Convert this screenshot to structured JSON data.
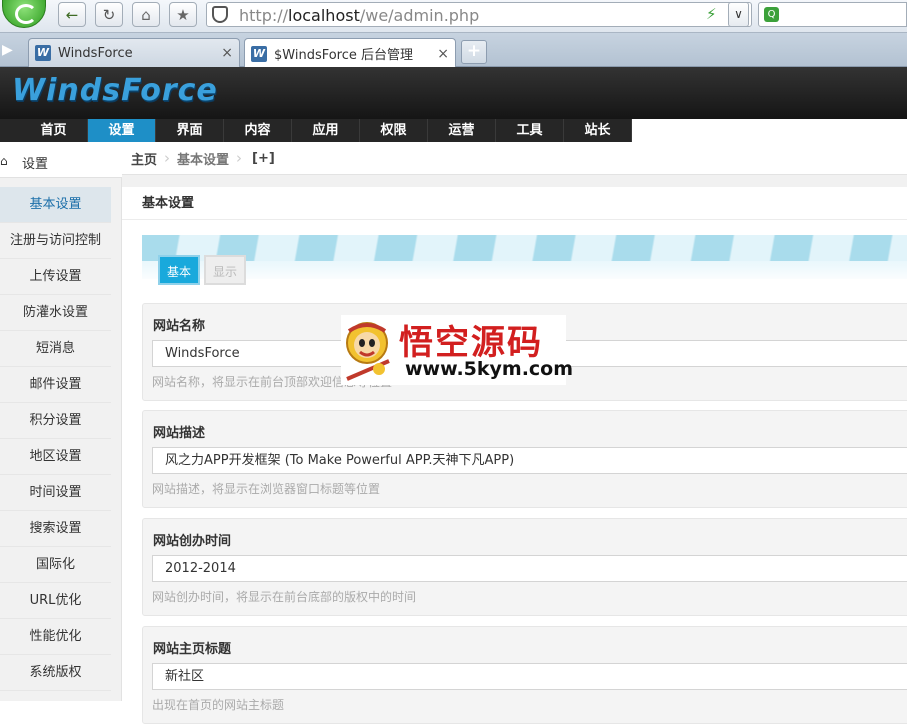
{
  "browser": {
    "url_prefix": "http://",
    "url_host": "localhost",
    "url_path": "/we/admin.php",
    "tabs": [
      {
        "title": "WindsForce",
        "favicon": "W"
      },
      {
        "title": "$WindsForce 后台管理",
        "favicon": "W"
      }
    ],
    "new_tab_label": "+",
    "close_label": "×",
    "search_engine_glyph": "Q"
  },
  "site": {
    "logo": "WindsForce",
    "nav": [
      "首页",
      "设置",
      "界面",
      "内容",
      "应用",
      "权限",
      "运营",
      "工具",
      "站长"
    ],
    "active_nav": "设置"
  },
  "sidebar": {
    "title": "设置",
    "items": [
      "基本设置",
      "注册与访问控制",
      "上传设置",
      "防灌水设置",
      "短消息",
      "邮件设置",
      "积分设置",
      "地区设置",
      "时间设置",
      "搜索设置",
      "国际化",
      "URL优化",
      "性能优化",
      "系统版权"
    ],
    "active": "基本设置"
  },
  "breadcrumb": {
    "home": "主页",
    "current": "基本设置",
    "add": "[+]"
  },
  "panel": {
    "title": "基本设置",
    "subtabs": [
      "基本",
      "显示"
    ]
  },
  "fields": [
    {
      "label": "网站名称",
      "value": "WindsForce",
      "help": "网站名称，将显示在前台顶部欢迎信息等位置"
    },
    {
      "label": "网站描述",
      "value": "风之力APP开发框架 (To Make Powerful APP.天神下凡APP)",
      "help": "网站描述，将显示在浏览器窗口标题等位置"
    },
    {
      "label": "网站创办时间",
      "value": "2012-2014",
      "help": "网站创办时间，将显示在前台底部的版权中的时间"
    },
    {
      "label": "网站主页标题",
      "value": "新社区",
      "help": "出现在首页的网站主标题"
    }
  ],
  "watermark": {
    "title": "悟空源码",
    "url": "www.5kym.com"
  },
  "colors": {
    "nav_active": "#1e8fc7",
    "sidebar_active_bg": "#dde6ec",
    "subtab_active": "#19a9dc",
    "logo_blue": "#3aa0dc",
    "watermark_red": "#d21f1f"
  },
  "icons": [
    "back-arrow-icon",
    "refresh-icon",
    "home-icon",
    "bookmark-star-icon",
    "security-shield-icon",
    "lightning-icon",
    "dropdown-chevron-icon"
  ]
}
